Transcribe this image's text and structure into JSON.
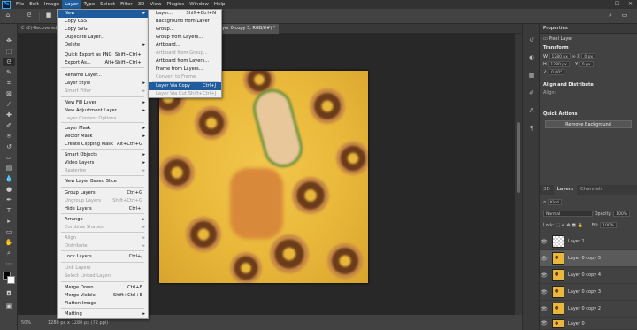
{
  "menubar": {
    "logo": "Ps",
    "items": [
      "File",
      "Edit",
      "Image",
      "Layer",
      "Type",
      "Select",
      "Filter",
      "3D",
      "View",
      "Plugins",
      "Window",
      "Help"
    ],
    "window_controls": [
      "—",
      "☐",
      "✕"
    ]
  },
  "tabs": [
    {
      "label": "C (2)-Recovered..."
    },
    {
      "label": "@ 50% (Layer 0 copy 5, RGB/8#) *"
    }
  ],
  "layer_menu": {
    "items": [
      {
        "label": "New",
        "arrow": "▸",
        "highlighted": true
      },
      {
        "label": "Copy CSS"
      },
      {
        "label": "Copy SVG"
      },
      {
        "label": "Duplicate Layer..."
      },
      {
        "label": "Delete",
        "arrow": "▸"
      },
      {
        "label": "Quick Export as PNG",
        "shortcut": "Shift+Ctrl+'"
      },
      {
        "label": "Export As...",
        "shortcut": "Alt+Shift+Ctrl+'"
      },
      {
        "label": "Rename Layer..."
      },
      {
        "label": "Layer Style",
        "arrow": "▸"
      },
      {
        "label": "Smart Filter",
        "arrow": "▸",
        "disabled": true
      },
      {
        "label": "New Fill Layer",
        "arrow": "▸"
      },
      {
        "label": "New Adjustment Layer",
        "arrow": "▸"
      },
      {
        "label": "Layer Content Options...",
        "disabled": true
      },
      {
        "label": "Layer Mask",
        "arrow": "▸"
      },
      {
        "label": "Vector Mask",
        "arrow": "▸"
      },
      {
        "label": "Create Clipping Mask",
        "shortcut": "Alt+Ctrl+G"
      },
      {
        "label": "Smart Objects",
        "arrow": "▸"
      },
      {
        "label": "Video Layers",
        "arrow": "▸"
      },
      {
        "label": "Rasterize",
        "arrow": "▸",
        "disabled": true
      },
      {
        "label": "New Layer Based Slice"
      },
      {
        "label": "Group Layers",
        "shortcut": "Ctrl+G"
      },
      {
        "label": "Ungroup Layers",
        "shortcut": "Shift+Ctrl+G",
        "disabled": true
      },
      {
        "label": "Hide Layers",
        "shortcut": "Ctrl+,"
      },
      {
        "label": "Arrange",
        "arrow": "▸"
      },
      {
        "label": "Combine Shapes",
        "arrow": "▸",
        "disabled": true
      },
      {
        "label": "Align",
        "arrow": "▸",
        "disabled": true
      },
      {
        "label": "Distribute",
        "arrow": "▸",
        "disabled": true
      },
      {
        "label": "Lock Layers...",
        "shortcut": "Ctrl+/"
      },
      {
        "label": "Link Layers",
        "disabled": true
      },
      {
        "label": "Select Linked Layers",
        "disabled": true
      },
      {
        "label": "Merge Down",
        "shortcut": "Ctrl+E"
      },
      {
        "label": "Merge Visible",
        "shortcut": "Shift+Ctrl+E"
      },
      {
        "label": "Flatten Image"
      },
      {
        "label": "Matting",
        "arrow": "▸"
      }
    ]
  },
  "new_submenu": {
    "items": [
      {
        "label": "Layer...",
        "shortcut": "Shift+Ctrl+N"
      },
      {
        "label": "Background from Layer"
      },
      {
        "label": "Group..."
      },
      {
        "label": "Group from Layers..."
      },
      {
        "label": "Artboard..."
      },
      {
        "label": "Artboard from Group...",
        "disabled": true
      },
      {
        "label": "Artboard from Layers..."
      },
      {
        "label": "Frame from Layers..."
      },
      {
        "label": "Convert to Frame",
        "disabled": true
      },
      {
        "label": "Layer Via Copy",
        "shortcut": "Ctrl+J",
        "highlighted": true
      },
      {
        "label": "Layer Via Cut",
        "shortcut": "Shift+Ctrl+J",
        "disabled": true
      }
    ]
  },
  "statusbar": {
    "zoom": "50%",
    "info": "1280 px x 1280 px (72 ppi)"
  },
  "properties": {
    "title": "Properties",
    "kind": "Pixel Layer",
    "transform_title": "Transform",
    "w": "1280 px",
    "h": "1280 px",
    "x": "0 px",
    "y": "0 px",
    "angle": "0.00°",
    "align_title": "Align and Distribute",
    "align_label": "Align:",
    "quick_title": "Quick Actions",
    "remove_bg": "Remove Background"
  },
  "layers_panel": {
    "tabs": [
      "3D",
      "Layers",
      "Channels"
    ],
    "filter": "Kind",
    "blend_mode": "Normal",
    "opacity_label": "Opacity:",
    "opacity": "100%",
    "lock_label": "Lock:",
    "fill_label": "Fill:",
    "fill": "100%",
    "layers": [
      {
        "name": "Layer 1",
        "transparent": true
      },
      {
        "name": "Layer 0 copy 5",
        "selected": true
      },
      {
        "name": "Layer 0 copy 4"
      },
      {
        "name": "Layer 0 copy 3"
      },
      {
        "name": "Layer 0 copy 2"
      },
      {
        "name": "Layer 0"
      }
    ]
  }
}
